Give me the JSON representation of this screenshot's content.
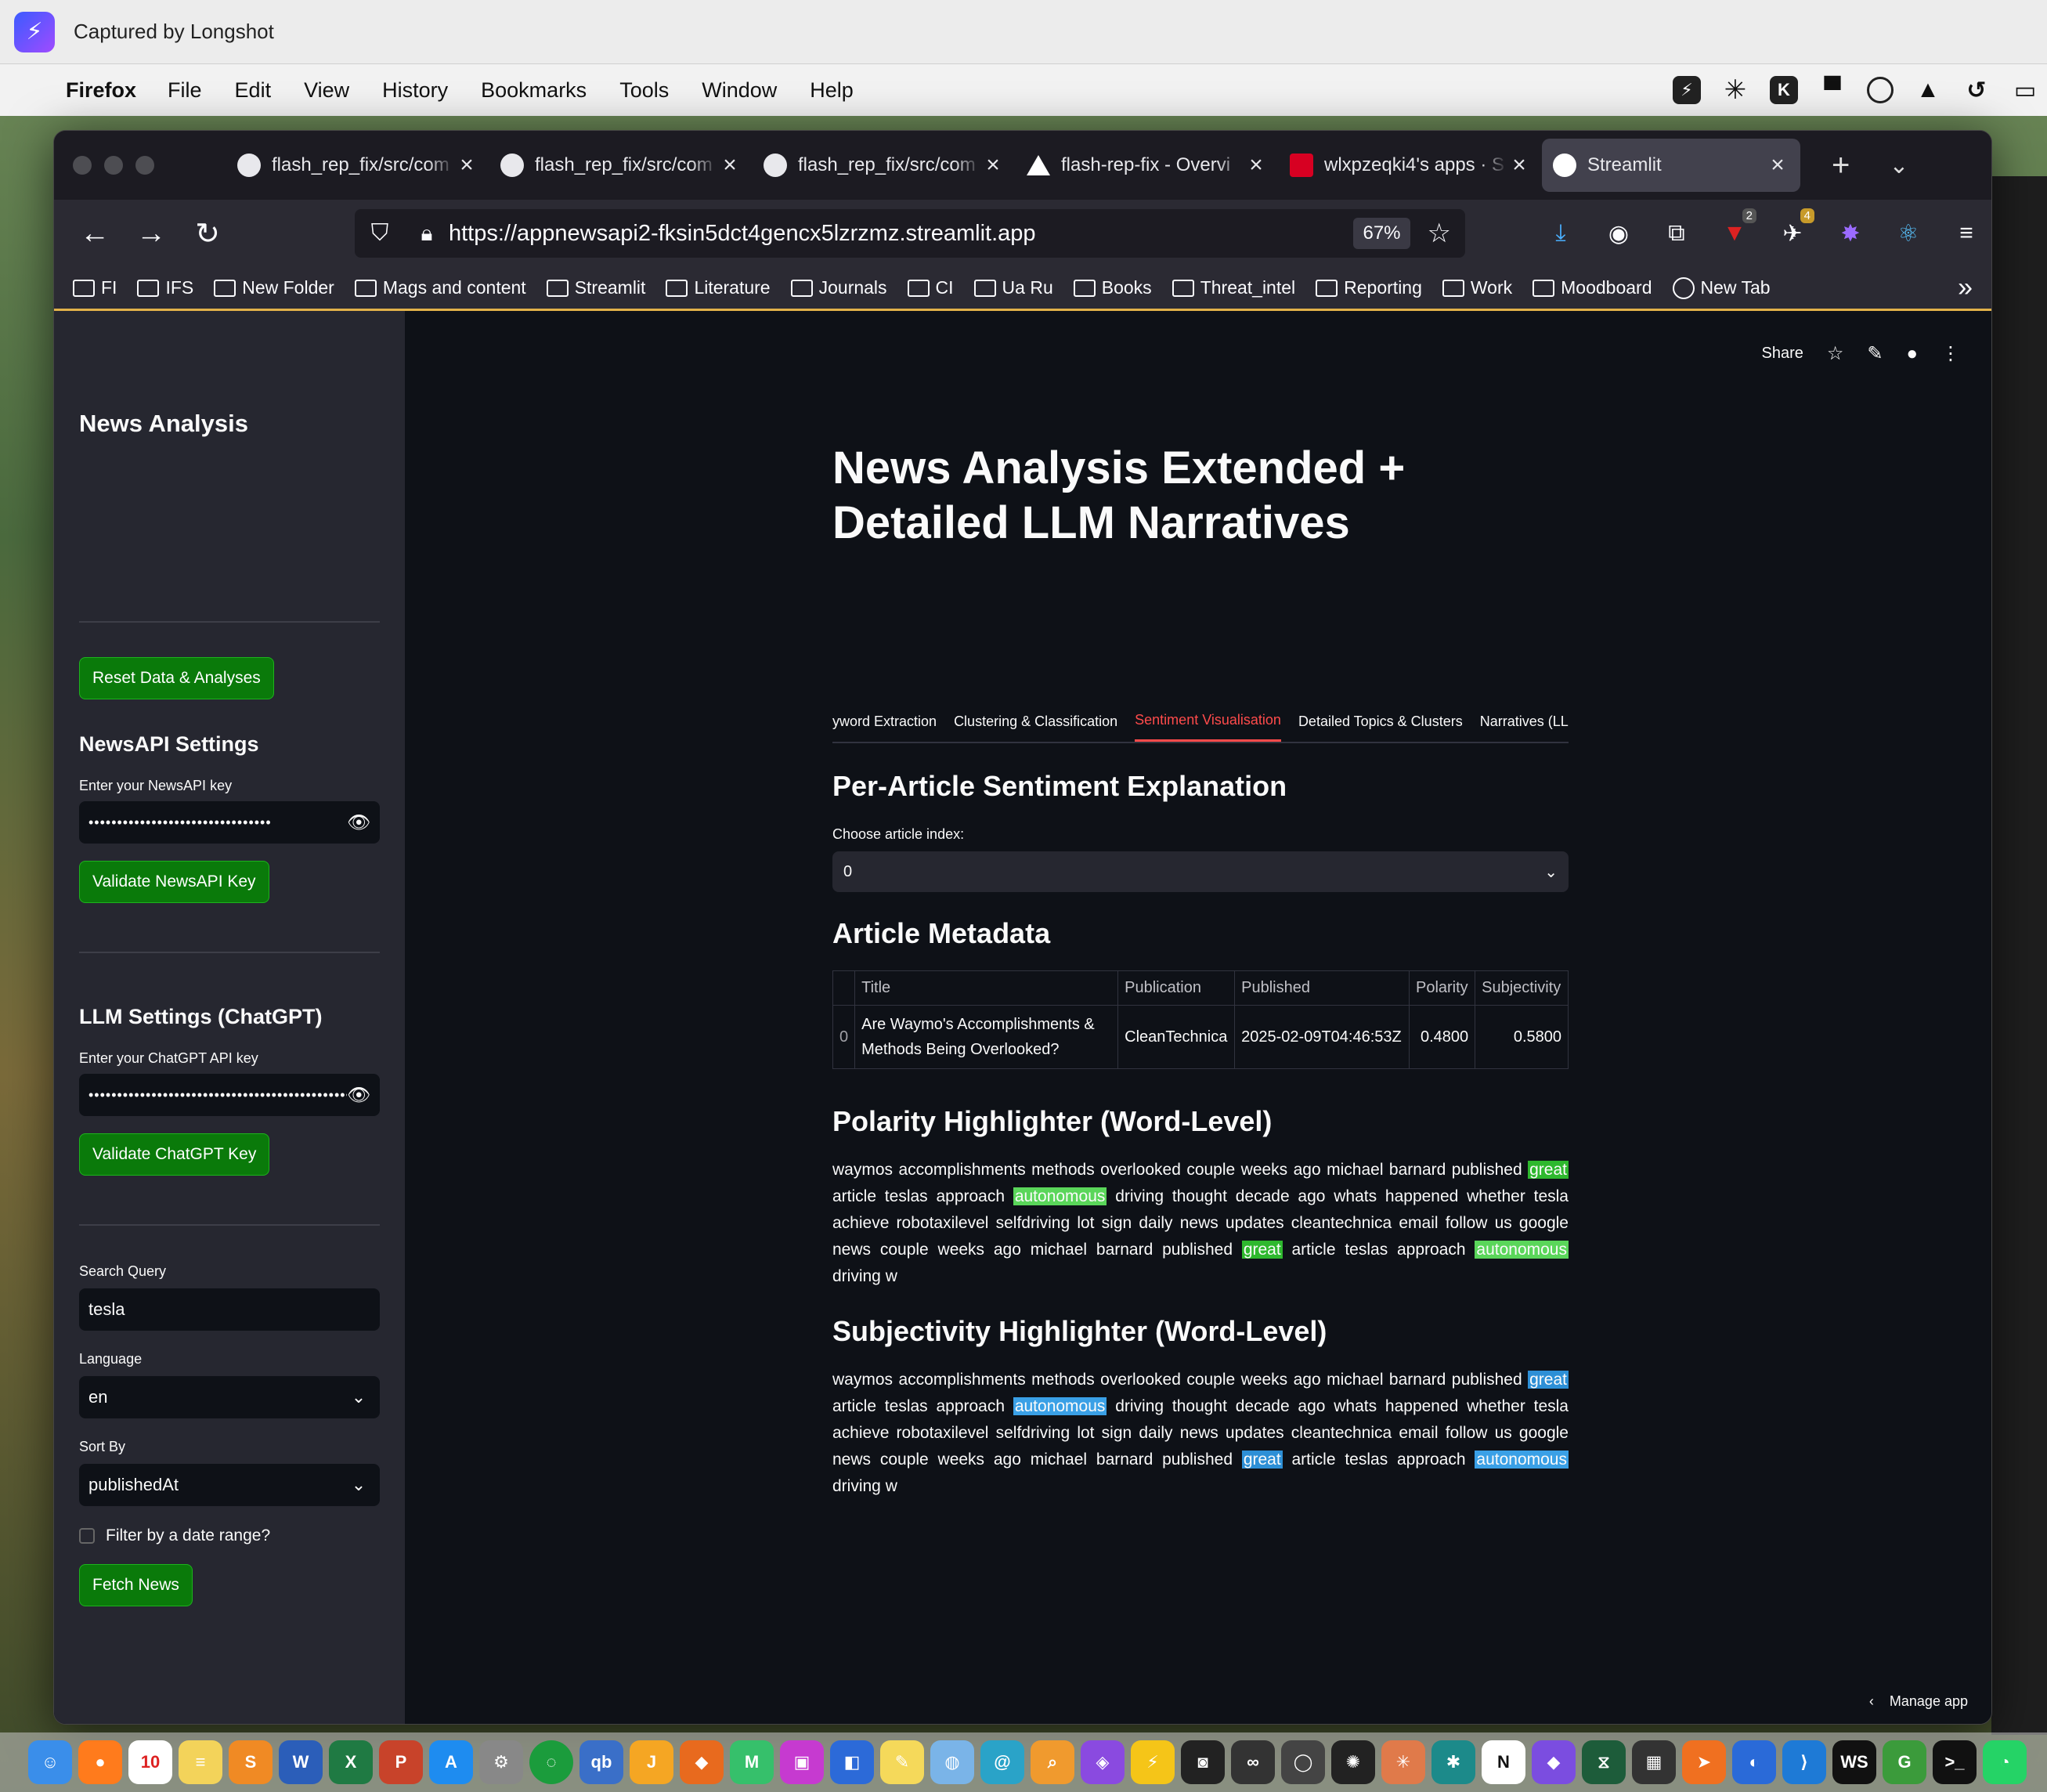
{
  "capture": {
    "title": "Captured by Longshot"
  },
  "menubar": {
    "app_name": "Firefox",
    "menus": [
      "File",
      "Edit",
      "View",
      "History",
      "Bookmarks",
      "Tools",
      "Window",
      "Help"
    ]
  },
  "browser": {
    "tabs": [
      {
        "label": "flash_rep_fix/src/com",
        "icon": "github-icon"
      },
      {
        "label": "flash_rep_fix/src/com",
        "icon": "github-icon"
      },
      {
        "label": "flash_rep_fix/src/com",
        "icon": "github-icon"
      },
      {
        "label": "flash-rep-fix - Overvi",
        "icon": "vercel-icon"
      },
      {
        "label": "wlxpzeqki4's apps · S",
        "icon": "streamlit-icon"
      },
      {
        "label": "Streamlit",
        "icon": "streamlit-icon",
        "active": true
      }
    ],
    "url": "https://appnewsapi2-fksin5dct4gencx5lzrzmz.streamlit.app",
    "zoom": "67%",
    "badges": {
      "ublock": "2",
      "extension": "4"
    },
    "bookmarks": [
      "FI",
      "IFS",
      "New Folder",
      "Mags and content",
      "Streamlit",
      "Literature",
      "Journals",
      "CI",
      "Ua Ru",
      "Books",
      "Threat_intel",
      "Reporting",
      "Work",
      "Moodboard",
      "New Tab"
    ]
  },
  "sidebar": {
    "title": "News Analysis",
    "reset_button": "Reset Data & Analyses",
    "newsapi_heading": "NewsAPI Settings",
    "newsapi_label": "Enter your NewsAPI key",
    "newsapi_value": "••••••••••••••••••••••••••••••••",
    "validate_newsapi": "Validate NewsAPI Key",
    "llm_heading": "LLM Settings (ChatGPT)",
    "chatgpt_label": "Enter your ChatGPT API key",
    "chatgpt_value": "••••••••••••••••••••••••••••••••••••••••••••••••••",
    "validate_chatgpt": "Validate ChatGPT Key",
    "search_label": "Search Query",
    "search_value": "tesla",
    "language_label": "Language",
    "language_value": "en",
    "sort_label": "Sort By",
    "sort_value": "publishedAt",
    "date_filter_label": "Filter by a date range?",
    "fetch_button": "Fetch News"
  },
  "header": {
    "share": "Share"
  },
  "main": {
    "title": "News Analysis Extended + Detailed LLM Narratives",
    "tabs": [
      "yword Extraction",
      "Clustering & Classification",
      "Sentiment Visualisation",
      "Detailed Topics & Clusters",
      "Narratives (LLM)"
    ],
    "active_tab": "Sentiment Visualisation",
    "per_article_heading": "Per-Article Sentiment Explanation",
    "choose_label": "Choose article index:",
    "choose_value": "0",
    "metadata_heading": "Article Metadata",
    "table": {
      "headers": [
        "",
        "Title",
        "Publication",
        "Published",
        "Polarity",
        "Subjectivity"
      ],
      "rows": [
        [
          "0",
          "Are Waymo's Accomplishments & Methods Being Overlooked?",
          "CleanTechnica",
          "2025-02-09T04:46:53Z",
          "0.4800",
          "0.5800"
        ]
      ]
    },
    "polarity_heading": "Polarity Highlighter (Word-Level)",
    "subjectivity_heading": "Subjectivity Highlighter (Word-Level)",
    "text_segments": [
      "waymos accomplishments methods overlooked couple weeks ago michael barnard published ",
      "great",
      " article teslas approach ",
      "autonomous",
      " driving thought decade ago whats happened whether tesla achieve robotaxilevel selfdriving lot sign daily news updates cleantechnica email follow us google news couple weeks ago michael barnard published ",
      "great",
      " article teslas approach ",
      "autonomous",
      " driving w"
    ],
    "manage_app": "Manage app"
  }
}
